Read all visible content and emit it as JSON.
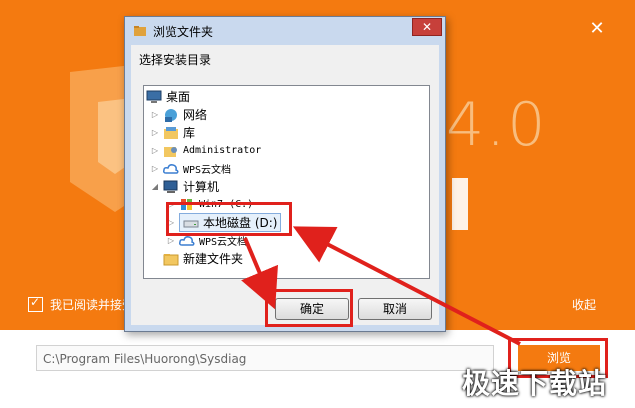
{
  "installer": {
    "version_graphic": "4.0",
    "agree_label": "我已阅读并接受",
    "collapse_label": "收起",
    "install_path": "C:\\Program Files\\Huorong\\Sysdiag",
    "browse_label": "浏览",
    "close_icon": "close-icon"
  },
  "dialog": {
    "title": "浏览文件夹",
    "instruction": "选择安装目录",
    "close_label": "✕",
    "tree": [
      {
        "label": "桌面",
        "icon": "desktop-icon"
      },
      {
        "label": "网络",
        "icon": "network-icon"
      },
      {
        "label": "库",
        "icon": "library-icon"
      },
      {
        "label": "Administrator",
        "icon": "user-folder-icon"
      },
      {
        "label": "WPS云文档",
        "icon": "cloud-icon"
      },
      {
        "label": "计算机",
        "icon": "computer-icon"
      },
      {
        "label": "Win7 (C:)",
        "icon": "windows-drive-icon"
      },
      {
        "label": "本地磁盘 (D:)",
        "icon": "drive-icon",
        "selected": true
      },
      {
        "label": "WPS云文档",
        "icon": "cloud-icon"
      },
      {
        "label": "新建文件夹",
        "icon": "folder-icon"
      }
    ],
    "ok_label": "确定",
    "cancel_label": "取消"
  },
  "watermark": "极速下载站",
  "colors": {
    "brand": "#f47a10",
    "annotation_red": "#e0211c"
  }
}
